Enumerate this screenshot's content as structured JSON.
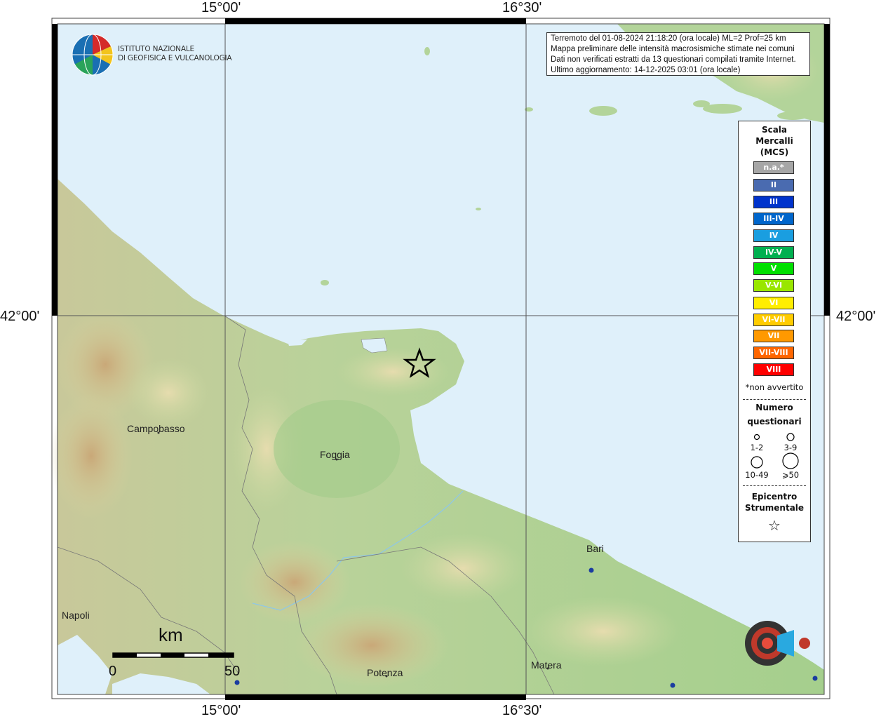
{
  "coords": {
    "top_lon_1": "15°00'",
    "top_lon_2": "16°30'",
    "bottom_lon_1": "15°00'",
    "bottom_lon_2": "16°30'",
    "left_lat": "42°00'",
    "right_lat": "42°00'"
  },
  "logo": {
    "line1": "ISTITUTO NAZIONALE",
    "line2": "DI GEOFISICA E VULCANOLOGIA"
  },
  "info": {
    "line1": "Terremoto del 01-08-2024 21:18:20 (ora locale) ML=2 Prof=25 km",
    "line2": "Mappa preliminare delle intensità macrosismiche stimate nei comuni",
    "line3": "Dati non verificati estratti da 13 questionari compilati tramite Internet.",
    "line4": "Ultimo aggiornamento: 14-12-2025 03:01 (ora locale)"
  },
  "legend": {
    "title1": "Scala",
    "title2": "Mercalli",
    "title3": "(MCS)",
    "intensities": [
      {
        "label": "n.a.*",
        "color": "#a6a6a6"
      },
      {
        "label": "II",
        "color": "#4a6bb0"
      },
      {
        "label": "III",
        "color": "#0033cc"
      },
      {
        "label": "III-IV",
        "color": "#0066cc"
      },
      {
        "label": "IV",
        "color": "#1a9ee0"
      },
      {
        "label": "IV-V",
        "color": "#00b050"
      },
      {
        "label": "V",
        "color": "#00e000"
      },
      {
        "label": "V-VI",
        "color": "#99e600"
      },
      {
        "label": "VI",
        "color": "#ffee00"
      },
      {
        "label": "VI-VII",
        "color": "#ffcc00"
      },
      {
        "label": "VII",
        "color": "#ff9900"
      },
      {
        "label": "VII-VIII",
        "color": "#ff6600"
      },
      {
        "label": "VIII",
        "color": "#ff0000"
      }
    ],
    "note": "*non avvertito",
    "num_title1": "Numero",
    "num_title2": "questionari",
    "size_1": "1-2",
    "size_2": "3-9",
    "size_3": "10-49",
    "size_4": "⩾50",
    "epi_title1": "Epicentro",
    "epi_title2": "Strumentale",
    "epi_symbol": "☆"
  },
  "cities": {
    "campobasso": "Campobasso",
    "foggia": "Foggia",
    "bari": "Bari",
    "napoli": "Napoli",
    "potenza": "Potenza",
    "matera": "Matera"
  },
  "scalebar": {
    "unit": "km",
    "start": "0",
    "end": "50"
  },
  "epicenter_symbol": "☆",
  "colors": {
    "sea": "#dff0fa",
    "land": "#a9cf8c"
  }
}
